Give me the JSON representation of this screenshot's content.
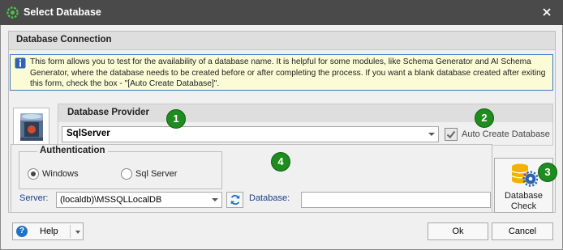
{
  "window": {
    "title": "Select Database",
    "app_icon": "app-gear-icon",
    "close_icon": "close-icon"
  },
  "database_connection": {
    "header": "Database Connection",
    "info_text": "This form allows you to test for the availability of a database name. It is helpful for some modules, like Schema Generator and AI Schema Generator, where the database needs to be created before or after completing the process. If you want a blank database created after exiting this form, check the box - \"[Auto Create Database]\".",
    "logo_icon": "sql-server-logo-icon"
  },
  "provider": {
    "header": "Database Provider",
    "value": "SqlServer",
    "auto_create_label": "Auto Create Database",
    "auto_create_checked": true
  },
  "authentication": {
    "legend": "Authentication",
    "options": [
      {
        "label": "Windows",
        "selected": true
      },
      {
        "label": "Sql Server",
        "selected": false
      }
    ]
  },
  "connection": {
    "server_label": "Server:",
    "server_value": "(localdb)\\MSSQLLocalDB",
    "database_label": "Database:",
    "database_value": ""
  },
  "database_check": {
    "label_line1": "Database",
    "label_line2": "Check",
    "icon": "database-gear-icon"
  },
  "footer": {
    "help_label": "Help",
    "ok_label": "Ok",
    "cancel_label": "Cancel"
  },
  "markers": [
    "1",
    "2",
    "3",
    "4"
  ],
  "colors": {
    "titlebar": "#4a4a4a",
    "info_background": "#fbfbd5",
    "info_border": "#3e78c4",
    "marker": "#1e8c1e",
    "label_blue": "#1b3f8b"
  }
}
